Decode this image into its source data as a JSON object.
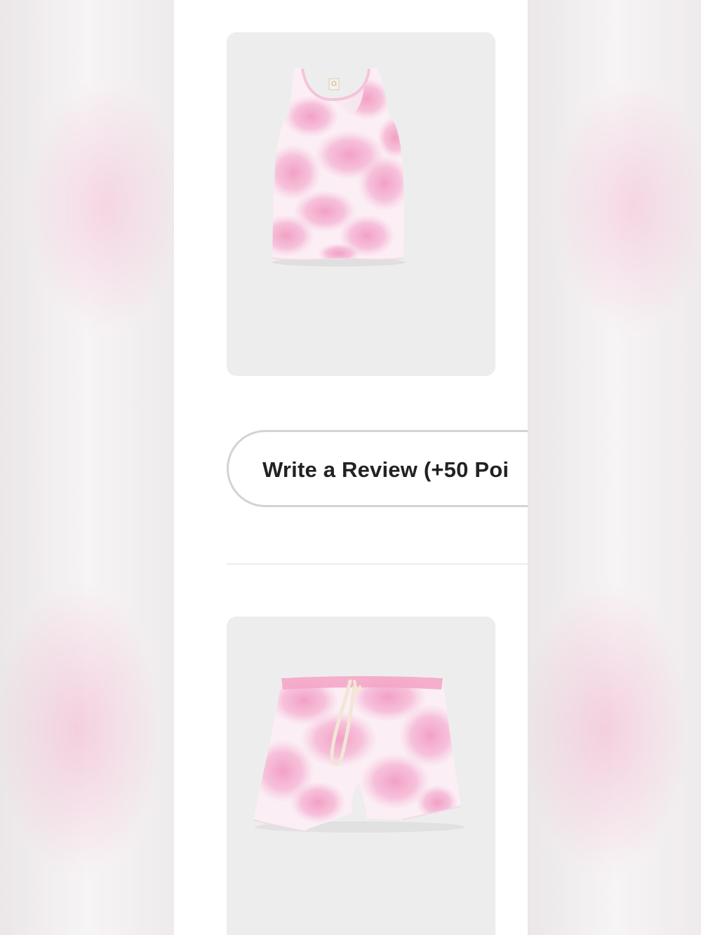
{
  "colors": {
    "page_background": "#ffffff",
    "card_background": "#ededed",
    "button_border": "#d3d3d3",
    "button_text": "#222222",
    "garment_pink": "#f4a9c9",
    "drawstring": "#f3e6d6"
  },
  "products": [
    {
      "icon": "tie-dye-tank-top-image"
    },
    {
      "icon": "tie-dye-shorts-image"
    }
  ],
  "review": {
    "button_label": "Write a Review (+50 Poi"
  }
}
